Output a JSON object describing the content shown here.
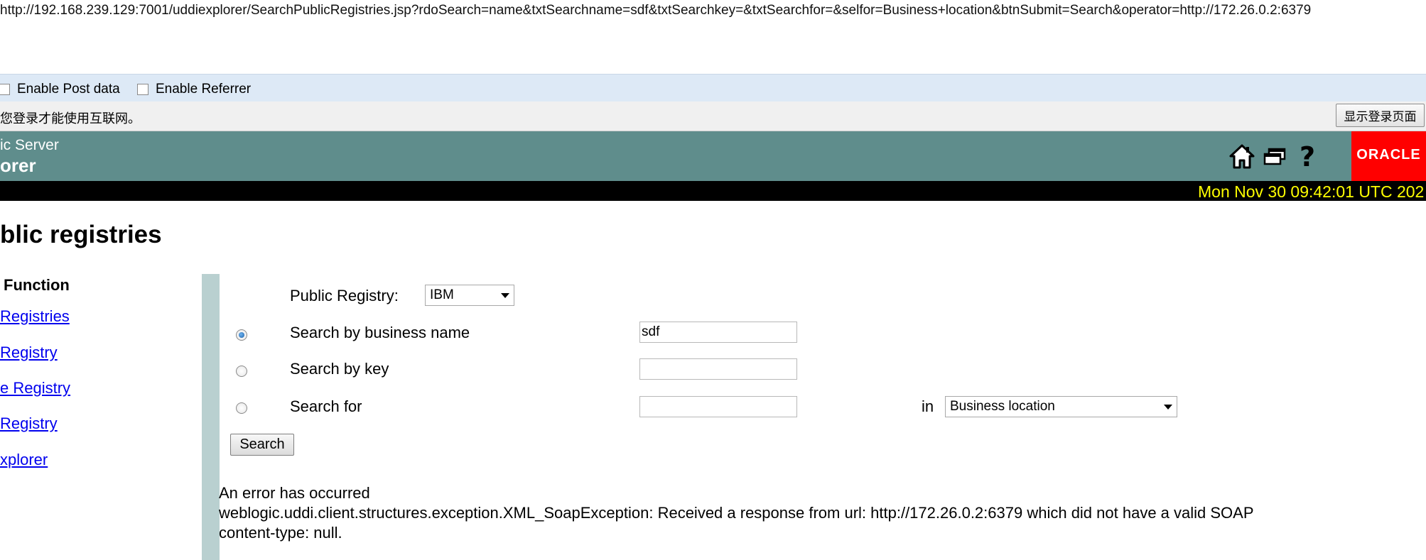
{
  "browser": {
    "url": "http://192.168.239.129:7001/uddiexplorer/SearchPublicRegistries.jsp?rdoSearch=name&txtSearchname=sdf&txtSearchkey=&txtSearchfor=&selfor=Business+location&btnSubmit=Search&operator=http://172.26.0.2:6379"
  },
  "hackbar": {
    "post_label": "Enable Post data",
    "referrer_label": "Enable Referrer"
  },
  "login_notice": {
    "text": "您登录才能使用互联网。",
    "button": "显示登录页面"
  },
  "header": {
    "line1": "ic Server",
    "line2": "orer",
    "logo_text": "ORACLE",
    "icons": [
      "home-icon",
      "windows-icon",
      "help-icon"
    ],
    "bg_color": "#5f8d8c",
    "logo_color": "#ff0000"
  },
  "datebar": {
    "text": "Mon Nov 30 09:42:01 UTC 202",
    "color": "#ffff00"
  },
  "page": {
    "title": "blic registries",
    "function_title": " Function",
    "nav": [
      "Registries",
      " Registry",
      "e Registry",
      "Registry",
      "xplorer"
    ]
  },
  "form": {
    "registry_label": "Public Registry:",
    "registry_value": "IBM",
    "name_label": "Search by business name",
    "name_value": "sdf",
    "key_label": "Search by key",
    "key_value": "",
    "for_label": "Search for",
    "for_value": "",
    "in_label": "in",
    "in_value": "Business location",
    "selected_radio": "name",
    "submit": "Search"
  },
  "error": {
    "line1": "An error has occurred",
    "line2": "weblogic.uddi.client.structures.exception.XML_SoapException: Received a response from url: http://172.26.0.2:6379 which did not have a valid SOAP",
    "line3": "content-type: null."
  }
}
